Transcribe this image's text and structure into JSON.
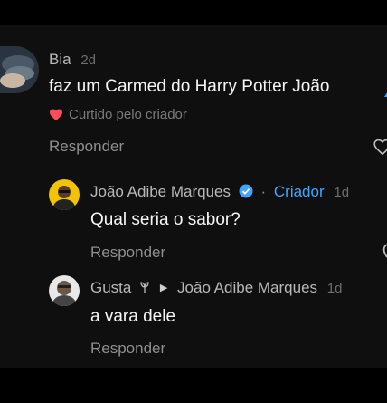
{
  "comments": [
    {
      "author": "Bia",
      "time": "2d",
      "text": "faz um Carmed do Harry Potter João",
      "liked_label": "Curtido pelo criador",
      "reply_label": "Responder"
    }
  ],
  "replies": [
    {
      "author": "João Adibe Marques",
      "creator_label": "Criador",
      "separator": "·",
      "time": "1d",
      "text": "Qual seria o sabor?",
      "reply_label": "Responder"
    },
    {
      "author": "Gusta",
      "reply_to": "João Adibe Marques",
      "time": "1d",
      "text": "a vara dele",
      "reply_label": "Responder"
    }
  ],
  "colors": {
    "background": "#0f0f0f",
    "creator": "#3ea6ff",
    "liked_heart": "#ff4d5a",
    "verified": "#3ea6ff"
  },
  "icons": [
    "avatar",
    "heart-icon",
    "like-icon",
    "verified-icon",
    "arrow-right-icon",
    "leaf-icon"
  ]
}
